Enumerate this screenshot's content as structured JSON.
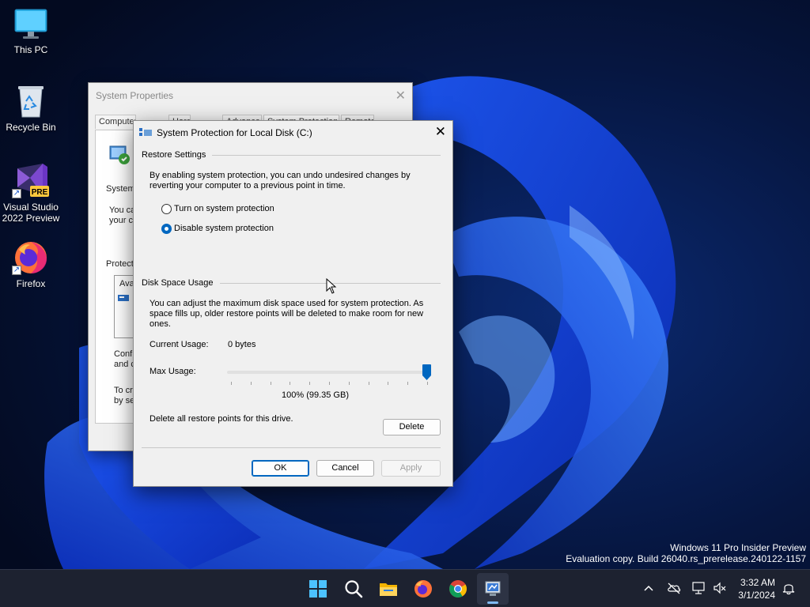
{
  "desktop": {
    "icons": [
      {
        "label": "This PC",
        "icon": "monitor-icon"
      },
      {
        "label": "Recycle Bin",
        "icon": "recycle-bin-icon"
      },
      {
        "label": "Visual Studio 2022 Preview",
        "badge": "PRE",
        "icon": "visual-studio-icon"
      },
      {
        "label": "Firefox",
        "icon": "firefox-icon"
      }
    ],
    "watermark": {
      "line1": "Windows 11 Pro Insider Preview",
      "line2": "Evaluation copy. Build 26040.rs_prerelease.240122-1157"
    }
  },
  "background_window": {
    "title": "System Properties",
    "close_glyph": "✕",
    "tabs": [
      "Computer Name",
      "Hardware",
      "Advanced",
      "System Protection",
      "Remote"
    ],
    "partial": {
      "section": "System",
      "line1": "You ca",
      "line2": "your co",
      "protection": "Protecti",
      "avail": "Ava",
      "config1": "Confi",
      "config2": "and c",
      "create1": "To cr",
      "create2": "by se"
    }
  },
  "dialog": {
    "title": "System Protection for Local Disk (C:)",
    "close_glyph": "✕",
    "restore": {
      "heading": "Restore Settings",
      "description": "By enabling system protection, you can undo undesired changes by reverting your computer to a previous point in time.",
      "options": [
        {
          "label": "Turn on system protection",
          "selected": false
        },
        {
          "label": "Disable system protection",
          "selected": true
        }
      ]
    },
    "disk": {
      "heading": "Disk Space Usage",
      "description": "You can adjust the maximum disk space used for system protection. As space fills up, older restore points will be deleted to make room for new ones.",
      "current_label": "Current Usage:",
      "current_value": "0 bytes",
      "max_label": "Max Usage:",
      "max_fraction": 1.0,
      "max_value": "100% (99.35 GB)",
      "delete_text": "Delete all restore points for this drive.",
      "delete_label": "Delete"
    },
    "buttons": {
      "ok": "OK",
      "cancel": "Cancel",
      "apply": "Apply"
    }
  },
  "taskbar": {
    "apps": [
      "start-icon",
      "search-icon",
      "file-explorer-icon",
      "firefox-icon",
      "chrome-icon",
      "system-properties-icon"
    ],
    "clock": {
      "time": "3:32 AM",
      "date": "3/1/2024"
    }
  },
  "colors": {
    "accent": "#0067c0",
    "taskbar": "#1d2230",
    "wallpaper": "#06122e"
  }
}
